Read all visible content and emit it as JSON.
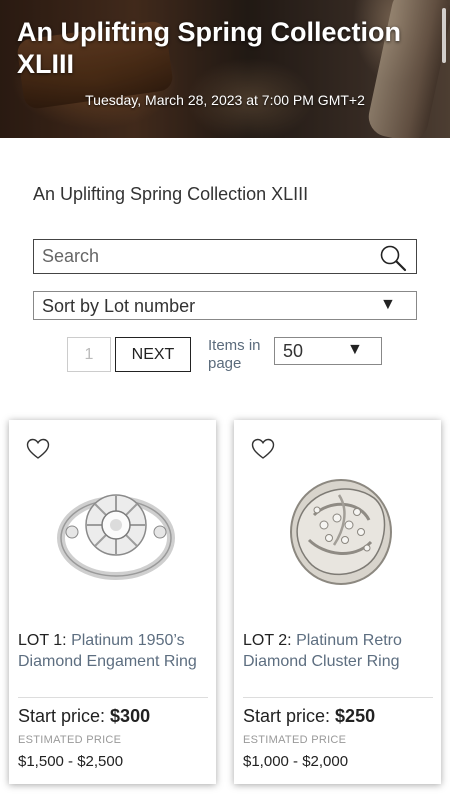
{
  "hero": {
    "title": "An Uplifting Spring Collection XLIII",
    "datetime": "Tuesday, March 28, 2023 at 7:00 PM GMT+2"
  },
  "collection_title": "An Uplifting Spring Collection XLIII",
  "search": {
    "placeholder": "Search",
    "icon": "search-icon"
  },
  "sort": {
    "label": "Sort by Lot number",
    "icon": "caret-down-icon"
  },
  "pager": {
    "page_value": "1",
    "next_label": "NEXT",
    "items_label": "Items in page",
    "items_value": "50"
  },
  "lots": [
    {
      "lot_label": "LOT 1:",
      "name": "Platinum 1950’s Diamond Engament Ring",
      "start_label": "Start price:",
      "start_price": "$300",
      "estimate_label": "ESTIMATED PRICE",
      "estimate": "$1,500 - $2,500"
    },
    {
      "lot_label": "LOT 2:",
      "name": "Platinum Retro Diamond Cluster Ring",
      "start_label": "Start price:",
      "start_price": "$250",
      "estimate_label": "ESTIMATED PRICE",
      "estimate": "$1,000 - $2,000"
    }
  ]
}
